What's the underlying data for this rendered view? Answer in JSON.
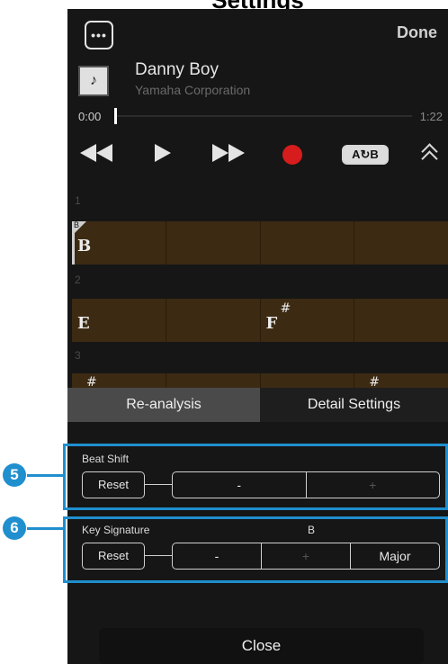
{
  "page_title": "Settings",
  "header": {
    "more_label": "•••",
    "done_label": "Done"
  },
  "song": {
    "icon": "music-note-icon",
    "icon_glyph": "♪",
    "title": "Danny Boy",
    "artist": "Yamaha Corporation"
  },
  "progress": {
    "start_time": "0:00",
    "end_time": "1:22",
    "position": 0.0
  },
  "transport": {
    "ab_label": "A↻B"
  },
  "chords": {
    "key_flag": "B",
    "rows": [
      {
        "bar": "1",
        "cells": [
          {
            "name": "B",
            "acc": ""
          },
          {
            "name": "",
            "acc": ""
          },
          {
            "name": "",
            "acc": ""
          },
          {
            "name": "",
            "acc": ""
          }
        ]
      },
      {
        "bar": "2",
        "cells": [
          {
            "name": "E",
            "acc": ""
          },
          {
            "name": "",
            "acc": ""
          },
          {
            "name": "F",
            "acc": "#"
          },
          {
            "name": "",
            "acc": ""
          }
        ]
      },
      {
        "bar": "3",
        "cells": [
          {
            "name": "",
            "acc": "#"
          },
          {
            "name": "",
            "acc": ""
          },
          {
            "name": "",
            "acc": ""
          },
          {
            "name": "",
            "acc": "#"
          }
        ]
      }
    ]
  },
  "tabs": {
    "reanalysis": "Re-analysis",
    "detail": "Detail Settings"
  },
  "beat_shift": {
    "label": "Beat Shift",
    "reset": "Reset",
    "minus": "-",
    "plus": "+"
  },
  "key_signature": {
    "label": "Key Signature",
    "value": "B",
    "reset": "Reset",
    "minus": "-",
    "plus": "+",
    "mode": "Major"
  },
  "close_label": "Close",
  "callouts": {
    "one": "5",
    "two": "6"
  },
  "colors": {
    "accent": "#1f8fce",
    "record": "#d61c1c",
    "chord_cell": "#3c2a12"
  }
}
